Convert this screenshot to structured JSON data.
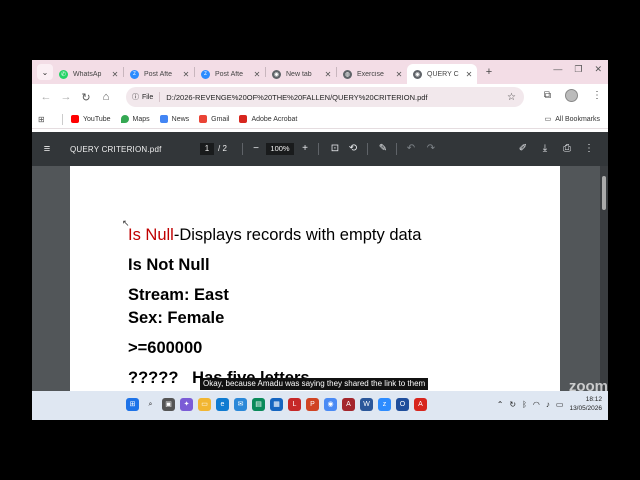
{
  "tabs": [
    {
      "title": "WhatsAp",
      "icon": "whatsapp-icon",
      "color": "#25d366",
      "active": false
    },
    {
      "title": "Post Afte",
      "icon": "zoom-icon",
      "color": "#2d8cff",
      "active": false
    },
    {
      "title": "Post Afte",
      "icon": "zoom-icon",
      "color": "#2d8cff",
      "active": false
    },
    {
      "title": "New tab",
      "icon": "chrome-icon",
      "color": "#5f6368",
      "active": false
    },
    {
      "title": "Exercise",
      "icon": "globe-icon",
      "color": "#5f6368",
      "active": false
    },
    {
      "title": "QUERY C",
      "icon": "chrome-icon",
      "color": "#5f6368",
      "active": true
    }
  ],
  "address": {
    "chip": "File",
    "url": "D:/2026-REVENGE%20OF%20THE%20FALLEN/QUERY%20CRITERION.pdf"
  },
  "bookmarks": {
    "items": [
      {
        "label": "YouTube",
        "icon": "youtube-icon",
        "color": "#ff0000"
      },
      {
        "label": "Maps",
        "icon": "maps-icon",
        "color": "#34a853"
      },
      {
        "label": "News",
        "icon": "news-icon",
        "color": "#4285f4"
      },
      {
        "label": "Gmail",
        "icon": "gmail-icon",
        "color": "#ea4335"
      },
      {
        "label": "Adobe Acrobat",
        "icon": "acrobat-icon",
        "color": "#d7261e"
      }
    ],
    "all_label": "All Bookmarks"
  },
  "pdf": {
    "filename": "QUERY CRITERION.pdf",
    "page_current": "1",
    "page_total": "/ 2",
    "zoom": "100%",
    "lines": {
      "l1_red": "Is Null",
      "l1_rest": "-Displays records with empty data",
      "l2": "Is Not Null",
      "l3": "Stream: East",
      "l4": "Sex: Female",
      "l5": ">=600000",
      "l6": "?????   Has five letters"
    }
  },
  "caption": "Okay, because Amadu was saying they shared the link to them",
  "taskbar": {
    "time": "18:12",
    "date": "13/05/2026"
  },
  "watermark": "zoom"
}
